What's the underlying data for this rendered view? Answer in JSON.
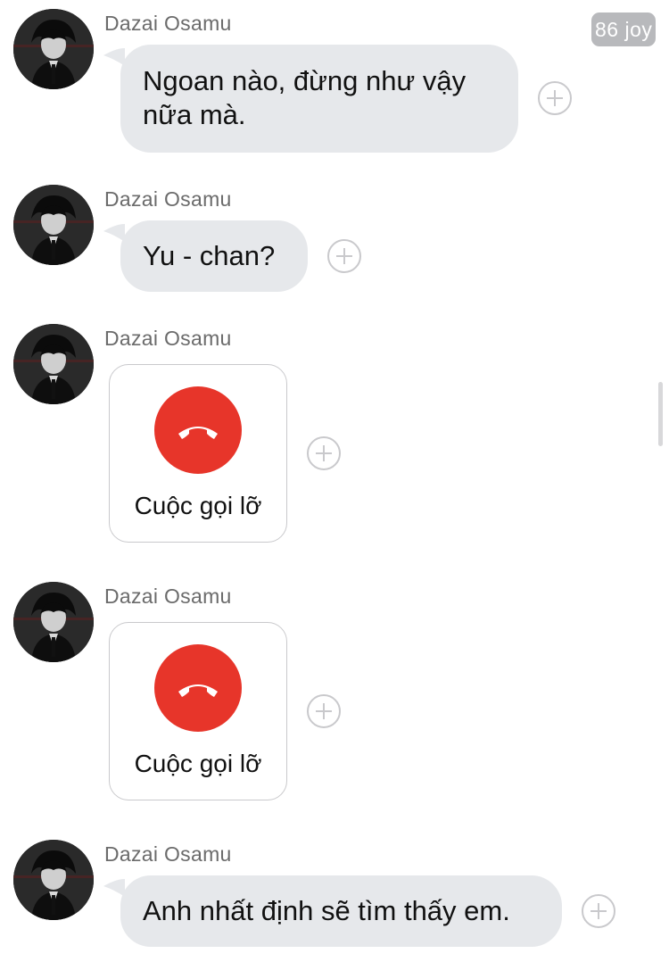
{
  "badge": {
    "text": "86 joy"
  },
  "messages": [
    {
      "sender": "Dazai Osamu",
      "type": "text",
      "text": "Ngoan nào, đừng như vậy nữa mà.",
      "avatar_icon": "avatar-icon"
    },
    {
      "sender": "Dazai Osamu",
      "type": "text",
      "text": "Yu - chan?",
      "avatar_icon": "avatar-icon"
    },
    {
      "sender": "Dazai Osamu",
      "type": "call",
      "text": "Cuộc gọi lỡ",
      "icon": "missed-call-icon",
      "icon_color": "#e7352a"
    },
    {
      "sender": "Dazai Osamu",
      "type": "call",
      "text": "Cuộc gọi lỡ",
      "icon": "missed-call-icon",
      "icon_color": "#e7352a"
    },
    {
      "sender": "Dazai Osamu",
      "type": "text",
      "text": "Anh nhất định sẽ tìm thấy em.",
      "avatar_icon": "avatar-icon"
    }
  ],
  "actions": {
    "add_icon": "plus-circle-icon"
  },
  "colors": {
    "bubble": "#e6e8eb",
    "missed_call": "#e7352a",
    "badge": "#b8b9bc"
  }
}
